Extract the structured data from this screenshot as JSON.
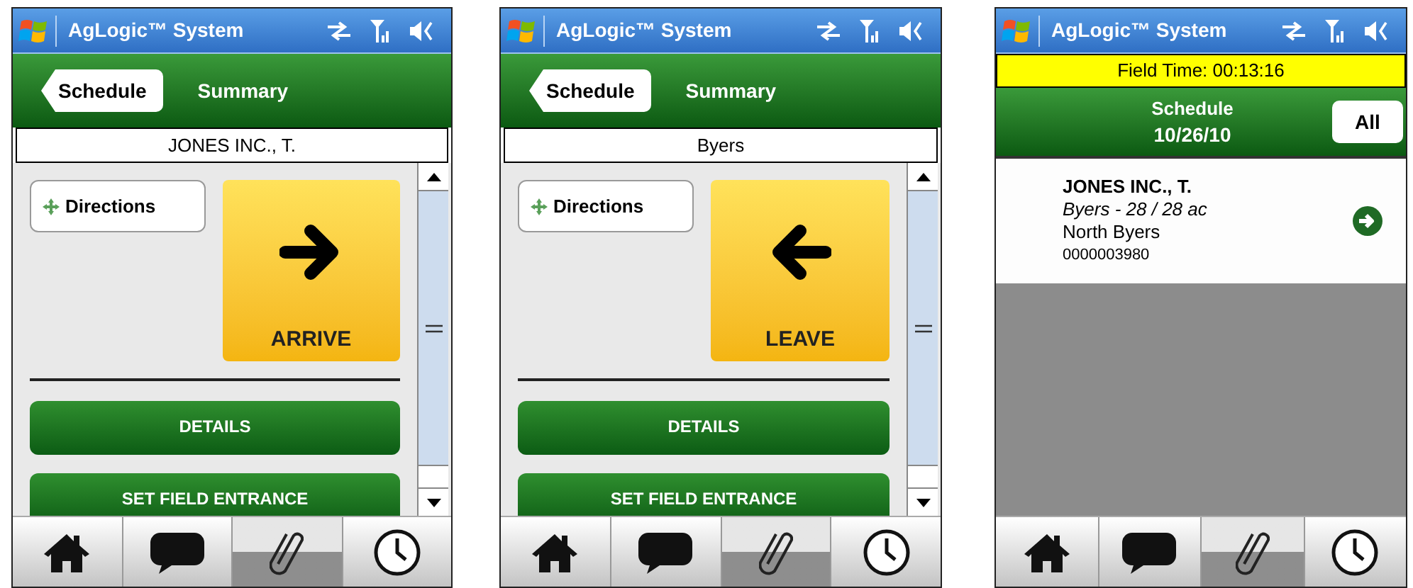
{
  "phones": [
    {
      "kind": "summary",
      "title": "AgLogic™ System",
      "back": "Schedule",
      "header": "Summary",
      "name": "JONES INC., T.",
      "directions": "Directions",
      "action": {
        "label": "ARRIVE",
        "kind": "arrive"
      },
      "buttons": [
        "DETAILS",
        "SET FIELD ENTRANCE"
      ],
      "tabs": [
        {
          "selected": false
        },
        {
          "selected": false
        },
        {
          "selected": true
        },
        {
          "selected": false
        }
      ]
    },
    {
      "kind": "summary",
      "title": "AgLogic™ System",
      "back": "Schedule",
      "header": "Summary",
      "name": "Byers",
      "directions": "Directions",
      "action": {
        "label": "LEAVE",
        "kind": "leave"
      },
      "buttons": [
        "DETAILS",
        "SET FIELD ENTRANCE"
      ],
      "tabs": [
        {
          "selected": false
        },
        {
          "selected": false
        },
        {
          "selected": true
        },
        {
          "selected": false
        }
      ]
    },
    {
      "kind": "schedule",
      "title": "AgLogic™ System",
      "field_time": "Field Time: 00:13:16",
      "header": "Schedule",
      "date": "10/26/10",
      "filter": "All",
      "items": [
        {
          "customer": "JONES INC., T.",
          "field": "Byers - 28 / 28 ac",
          "location": "North Byers",
          "number": "0000003980"
        }
      ],
      "tabs": [
        {
          "selected": false
        },
        {
          "selected": false
        },
        {
          "selected": true
        },
        {
          "selected": false
        }
      ]
    }
  ]
}
